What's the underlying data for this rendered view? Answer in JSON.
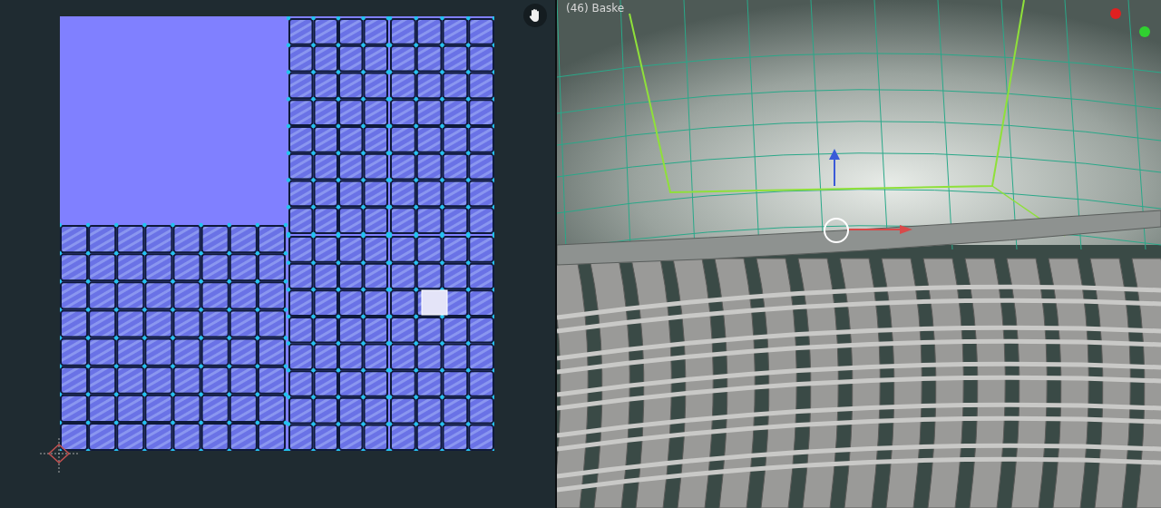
{
  "viewport": {
    "object_label": "(46) Baske"
  }
}
